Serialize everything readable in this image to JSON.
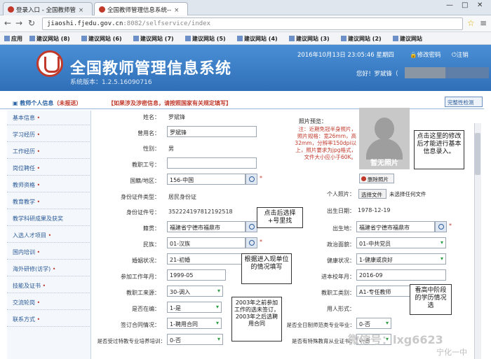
{
  "browser": {
    "tabs": [
      {
        "label": "登录入口 - 全国教师管"
      },
      {
        "label": "全国教师管理信息系统--"
      }
    ],
    "url_host": "jiaoshi.fjedu.gov.cn",
    "url_path": ":8082/selfservice/index",
    "bookmarks": [
      "应用",
      "建议网站 (8)",
      "建议网站 (6)",
      "建议网站 (7)",
      "建议网站 (5)",
      "建议网站 (4)",
      "建议网站 (3)",
      "建议网站 (2)",
      "建议网站"
    ]
  },
  "header": {
    "title": "全国教师管理信息系统",
    "version": "系统版本：1.2.5.16090716",
    "date": "2016年10月13日 23:05:46 星期四",
    "change_password": "修改密码",
    "logout": "注销",
    "greeting": "您好！罗斌锋（"
  },
  "page": {
    "section_title": "教师个人信息",
    "section_status": "（未报送）",
    "notice": "【如果涉及涉密信息，请按照国家有关规定填写】",
    "check_button": "完整性检测"
  },
  "sidebar": {
    "items": [
      {
        "label": "基本信息"
      },
      {
        "label": "学习经历"
      },
      {
        "label": "工作经历"
      },
      {
        "label": "岗位聘任"
      },
      {
        "label": "教师资格"
      },
      {
        "label": "教育教学"
      },
      {
        "label": "教学科研成果及获奖"
      },
      {
        "label": "入选人才项目"
      },
      {
        "label": "国内培训"
      },
      {
        "label": "海外研修(访学)"
      },
      {
        "label": "技能及证书"
      },
      {
        "label": "交流轮岗"
      },
      {
        "label": "联系方式"
      }
    ]
  },
  "form": {
    "name_label": "姓名：",
    "name_value": "罗斌锋",
    "alias_label": "曾用名：",
    "alias_value": "罗斌锋",
    "gender_label": "性别：",
    "gender_value": "男",
    "staff_no_label": "教职工号：",
    "nation_label": "国籍/地区：",
    "nation_value": "156-中国",
    "id_type_label": "身份证件类型：",
    "id_type_value": "居民身份证",
    "id_no_label": "身份证件号：",
    "id_no_value": "352224197812192518",
    "origin_label": "籍贯：",
    "origin_value": "福建省宁德市福鼎市",
    "ethnic_label": "民族：",
    "ethnic_value": "01-汉族",
    "marital_label": "婚姻状况：",
    "marital_value": "21-初婚",
    "workstart_label": "参加工作年月：",
    "workstart_value": "1999-05",
    "source_label": "教职工来源：",
    "source_value": "30-调入",
    "staffing_label": "是否在编：",
    "staffing_value": "1-是",
    "contract_label": "签订合同情况：",
    "contract_value": "1-聘用合同",
    "special_training_label": "是否受过特教专业培养培训：",
    "special_training_value": "0-否",
    "photo_preview_label": "照片预览：",
    "photo_note": "注：近期免冠半身照片，照片规格：宽26mm，高32mm，分辨率150dpi以上，照片要求为jpg格式，文件大小应小于60K。",
    "no_photo": "暂无照片",
    "delete_photo": "删除照片",
    "personal_photo_label": "个人照片：",
    "choose_file": "选择文件",
    "no_file": "未选择任何文件",
    "birth_label": "出生日期：",
    "birth_value": "1978-12-19",
    "birthplace_label": "出生地：",
    "birthplace_value": "福建省宁德市福鼎市",
    "political_label": "政治面貌：",
    "political_value": "01-中共党员",
    "health_label": "健康状况：",
    "health_value": "1-健康或良好",
    "join_school_label": "进本校年月：",
    "join_school_value": "2016-09",
    "staff_type_label": "教职工类别：",
    "staff_type_value": "A1-专任教师",
    "employ_form_label": "用人形式：",
    "full_time_grad_label": "是否全日制师范类专业毕业：",
    "full_time_grad_value": "0-否",
    "special_edu_label": "是否有特殊教育从业证书：",
    "special_edu_value": "0-否"
  },
  "callouts": {
    "photo_hint": "点击这里的修改后才能进行基本信息录入。",
    "origin_hint": "点击后选择+号里找",
    "entry_hint": "根据进入现单位的情况填写",
    "contract_hint": "2003年之前参加工作的选未签订，2003年之后选聘用合同",
    "grad_hint": "看高中阶段的学历情况选"
  },
  "watermark": {
    "wechat": "微信号：lxg6623",
    "site": "宁化一中"
  }
}
